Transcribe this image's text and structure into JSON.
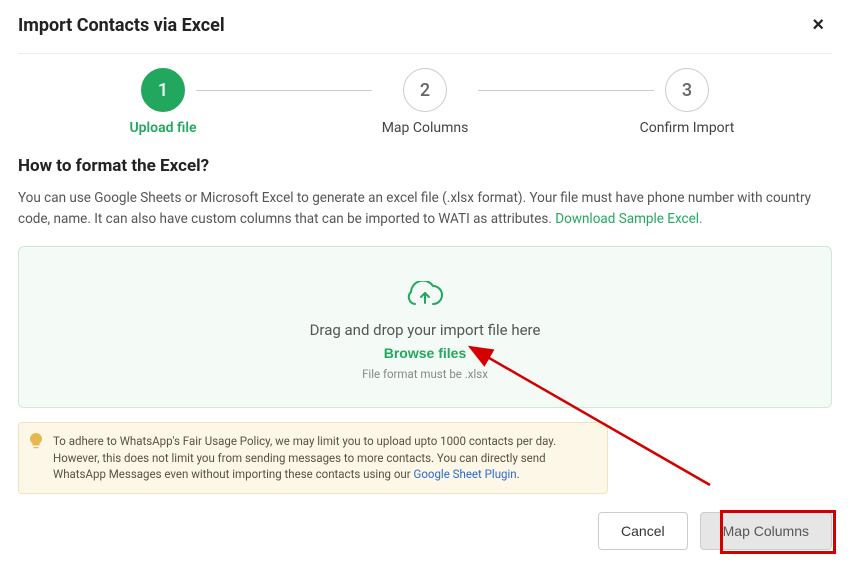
{
  "header": {
    "title": "Import Contacts via Excel",
    "close": "×"
  },
  "stepper": {
    "steps": [
      {
        "num": "1",
        "label": "Upload file"
      },
      {
        "num": "2",
        "label": "Map Columns"
      },
      {
        "num": "3",
        "label": "Confirm Import"
      }
    ]
  },
  "section": {
    "subtitle": "How to format the Excel?",
    "help_pre": "You can use Google Sheets or Microsoft Excel to generate an excel file (.xlsx format). Your file must have phone number with country code, name. It can also have custom columns that can be imported to WATI as attributes. ",
    "help_link": "Download Sample Excel."
  },
  "dropzone": {
    "main": "Drag and drop your import file here",
    "browse": "Browse files",
    "hint": "File format must be .xlsx"
  },
  "notice": {
    "text_pre": "To adhere to WhatsApp's Fair Usage Policy, we may limit you to upload upto 1000 contacts per day. However, this does not limit you from sending messages to more contacts. You can directly send WhatsApp Messages even without importing these contacts using our ",
    "link": "Google Sheet Plugin",
    "text_post": "."
  },
  "footer": {
    "cancel": "Cancel",
    "next": "Map Columns"
  }
}
